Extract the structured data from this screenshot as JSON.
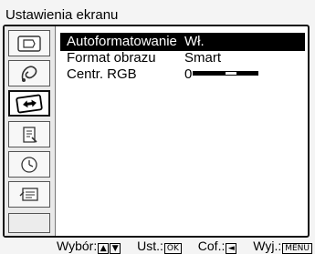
{
  "menu": {
    "title": "Ustawienia ekranu"
  },
  "sidebar": {
    "items": [
      {
        "icon": "picture-adjust-icon"
      },
      {
        "icon": "sound-icon"
      },
      {
        "icon": "screen-control-icon",
        "selected": true
      },
      {
        "icon": "setup-icon"
      },
      {
        "icon": "timer-icon"
      },
      {
        "icon": "pc-settings-icon"
      },
      {
        "icon": "blank"
      }
    ]
  },
  "settings": [
    {
      "label": "Autoformatowanie",
      "value": "Wł.",
      "selected": true
    },
    {
      "label": "Format obrazu",
      "value": "Smart"
    },
    {
      "label": "Centr. RGB",
      "value": "0",
      "slider_fraction": 0.6
    }
  ],
  "footer": {
    "select_label": "Wybór:",
    "select_keys": [
      "▲",
      "▼"
    ],
    "confirm_label": "Ust.:",
    "confirm_key": "OK",
    "back_label": "Cof.:",
    "back_key": "◄",
    "exit_label": "Wyj.:",
    "exit_key": "MENU"
  }
}
